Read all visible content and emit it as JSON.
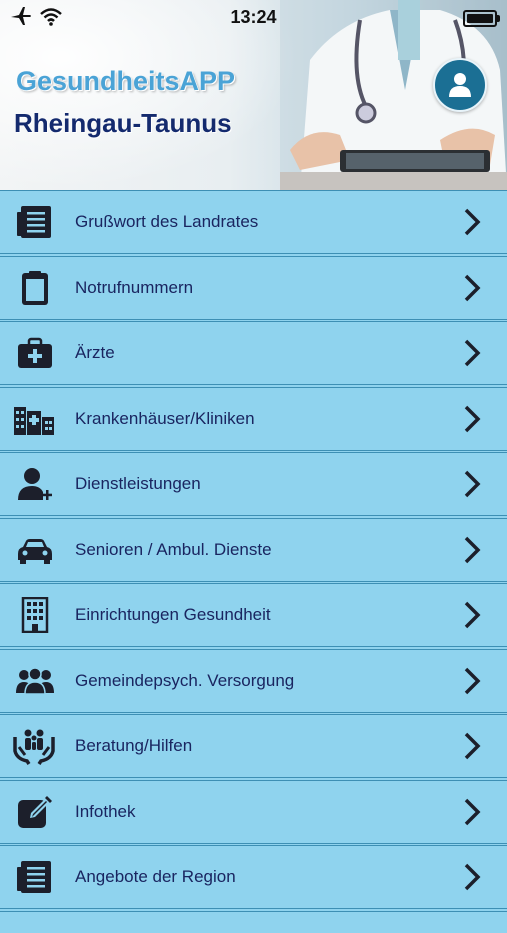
{
  "status_bar": {
    "time": "13:24",
    "airplane_icon": "airplane-icon",
    "wifi_icon": "wifi-icon",
    "battery_icon": "battery-icon"
  },
  "header": {
    "title_line1": "GesundheitsAPP",
    "title_line2": "Rheingau-Taunus",
    "profile_icon": "person-icon"
  },
  "menu": {
    "items": [
      {
        "label": "Grußwort des Landrates",
        "icon": "document-list-icon"
      },
      {
        "label": "Notrufnummern",
        "icon": "clipboard-icon"
      },
      {
        "label": "Ärzte",
        "icon": "medical-bag-icon"
      },
      {
        "label": "Krankenhäuser/Kliniken",
        "icon": "hospital-buildings-icon"
      },
      {
        "label": "Dienstleistungen",
        "icon": "person-plus-icon"
      },
      {
        "label": "Senioren / Ambul. Dienste",
        "icon": "car-icon"
      },
      {
        "label": "Einrichtungen Gesundheit",
        "icon": "building-icon"
      },
      {
        "label": "Gemeindepsych. Versorgung",
        "icon": "group-icon"
      },
      {
        "label": "Beratung/Hilfen",
        "icon": "family-hands-icon"
      },
      {
        "label": "Infothek",
        "icon": "edit-icon"
      },
      {
        "label": "Angebote der Region",
        "icon": "document-list-icon"
      }
    ]
  },
  "colors": {
    "menu_background": "#8fd3ee",
    "menu_border": "#3d8fb4",
    "text": "#1a2560",
    "title_dark": "#142a6e",
    "title_light": "#4aa3d6"
  }
}
